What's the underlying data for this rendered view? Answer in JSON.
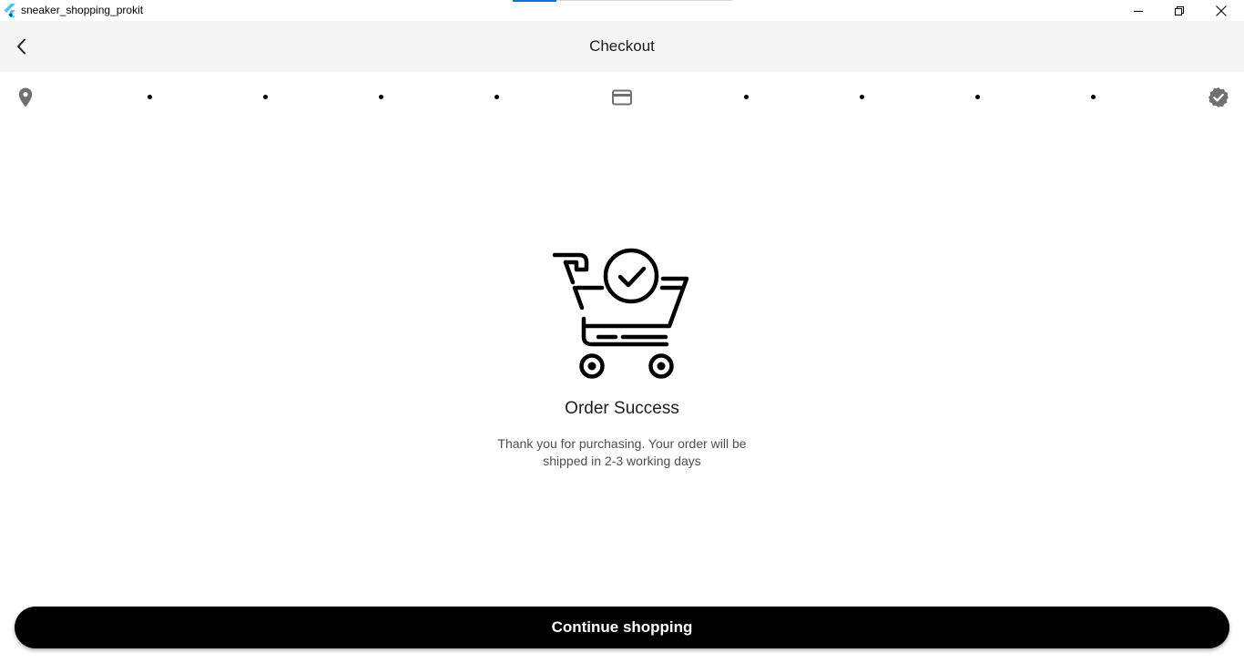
{
  "window": {
    "title": "sneaker_shopping_prokit",
    "app_icon": "flutter-logo-icon",
    "controls": [
      "minimize-icon",
      "restore-icon",
      "close-icon"
    ]
  },
  "appbar": {
    "title": "Checkout",
    "back_icon": "chevron-left-icon"
  },
  "steps": {
    "icons": [
      "location-pin-icon",
      "credit-card-icon",
      "verified-badge-icon"
    ],
    "dots_between": 4
  },
  "success": {
    "illustration": "cart-check-icon",
    "title": "Order Success",
    "message": "Thank you for purchasing. Your order will be shipped in 2-3 working days"
  },
  "actions": {
    "continue_label": "Continue shopping"
  },
  "colors": {
    "appbar_bg": "#f5f5f5",
    "step_icon": "#6e6e6e",
    "button_bg": "#000000",
    "button_text": "#ffffff"
  }
}
